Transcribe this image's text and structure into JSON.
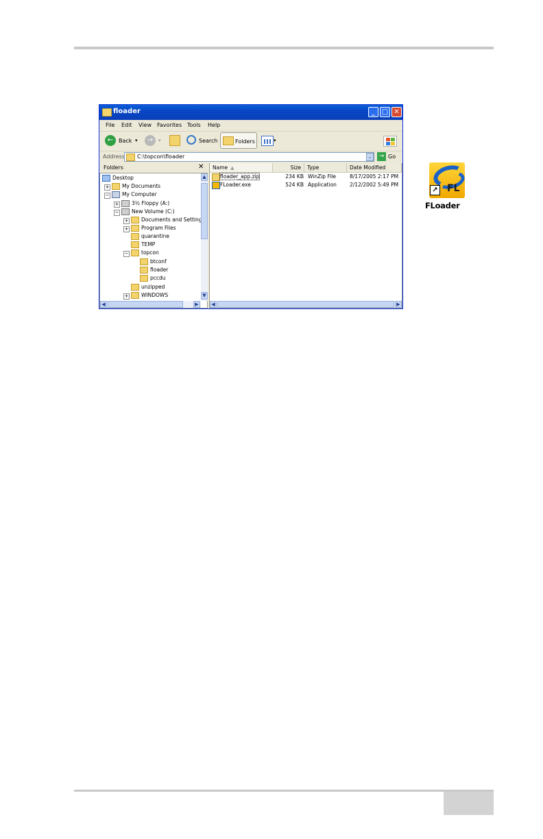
{
  "window": {
    "title": "floader",
    "controls": {
      "minimize": "_",
      "maximize": "□",
      "close": "✕"
    }
  },
  "menu": [
    "File",
    "Edit",
    "View",
    "Favorites",
    "Tools",
    "Help"
  ],
  "toolbar": {
    "back_label": "Back",
    "search_label": "Search",
    "folders_label": "Folders",
    "back_glyph": "←",
    "forward_glyph": "→",
    "caret": "▾"
  },
  "address": {
    "label": "Address",
    "value": "C:\\topcon\\floader",
    "drop_glyph": "⌄",
    "go_glyph": "→",
    "go_label": "Go"
  },
  "folders_pane": {
    "title": "Folders",
    "close": "✕",
    "items": [
      {
        "label": "Desktop",
        "icon": "desktop-icon",
        "expander": ""
      },
      {
        "label": "My Documents",
        "icon": "folder-icon",
        "expander": "+"
      },
      {
        "label": "My Computer",
        "icon": "computer-icon",
        "expander": "−"
      },
      {
        "label": "3½ Floppy (A:)",
        "icon": "floppy-icon",
        "expander": "+"
      },
      {
        "label": "New Volume (C:)",
        "icon": "drive-icon",
        "expander": "−"
      },
      {
        "label": "Documents and Settings",
        "icon": "folder-icon",
        "expander": "+"
      },
      {
        "label": "Program Files",
        "icon": "folder-icon",
        "expander": "+"
      },
      {
        "label": "quarantine",
        "icon": "folder-icon",
        "expander": ""
      },
      {
        "label": "TEMP",
        "icon": "folder-icon",
        "expander": ""
      },
      {
        "label": "topcon",
        "icon": "folder-icon",
        "expander": "−"
      },
      {
        "label": "btconf",
        "icon": "folder-icon",
        "expander": ""
      },
      {
        "label": "floader",
        "icon": "folder-icon",
        "expander": ""
      },
      {
        "label": "pccdu",
        "icon": "folder-icon",
        "expander": ""
      },
      {
        "label": "unzipped",
        "icon": "folder-icon",
        "expander": ""
      },
      {
        "label": "WINDOWS",
        "icon": "folder-icon",
        "expander": "+"
      }
    ]
  },
  "files": {
    "columns": {
      "name": "Name",
      "size": "Size",
      "type": "Type",
      "modified": "Date Modified"
    },
    "sort_glyph": "▲",
    "rows": [
      {
        "name": "floader_app.zip",
        "size": "234 KB",
        "type": "WinZip File",
        "modified": "8/17/2005 2:17 PM",
        "icon": "zip-icon"
      },
      {
        "name": "FLoader.exe",
        "size": "524 KB",
        "type": "Application",
        "modified": "2/12/2002 5:49 PM",
        "icon": "exe-icon"
      }
    ]
  },
  "scroll": {
    "up": "▲",
    "down": "▼",
    "left": "◀",
    "right": "▶"
  },
  "shortcut": {
    "label": "FLoader",
    "tile_text": "FL",
    "arrow_glyph": "↗",
    "colors": {
      "tile": "#f5b800",
      "swirl": "#1b62c8"
    }
  }
}
